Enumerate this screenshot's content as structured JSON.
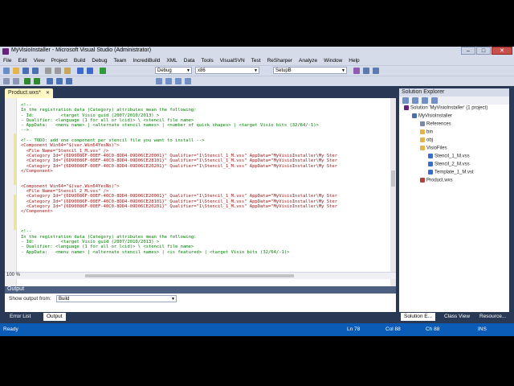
{
  "window": {
    "title": "MyVisioInstaller - Microsoft Visual Studio (Administrator)"
  },
  "menu": [
    "File",
    "Edit",
    "View",
    "Project",
    "Build",
    "Debug",
    "Team",
    "IncrediBuild",
    "XML",
    "Data",
    "Tools",
    "VisualSVN",
    "Test",
    "ReSharper",
    "Analyze",
    "Window",
    "Help"
  ],
  "toolbar": {
    "config": "Debug",
    "platform": "x86",
    "startup": "SetupB"
  },
  "editor": {
    "tab": "Product.wxs*",
    "zoom": "100 %",
    "lines": [
      {
        "c": "cm",
        "t": "<!--"
      },
      {
        "c": "cm",
        "t": "In the registration data (Category) attributes mean the following:"
      },
      {
        "c": "cm",
        "t": "- Id:          <target Visio guid (2007/2010/2013) >"
      },
      {
        "c": "cm",
        "t": "- Qualifier: <language (1 for all or lcid)> \\ <stencil file name>"
      },
      {
        "c": "cm",
        "t": "- AppData:   <menu name> | <alternate stencil names> | <number of quick shapes> | <target Visio bits (32/64/-1)>"
      },
      {
        "c": "cm",
        "t": "-->"
      },
      {
        "c": "",
        "t": ""
      },
      {
        "c": "cm",
        "t": "<!-- TODO: add one component per stencil file you want to install -->"
      },
      {
        "c": "tg",
        "t": "<Component Win64=\"$(var.Win64YesNo)\">"
      },
      {
        "c": "tg",
        "t": "  <File Name=\"Stencil_1_M.vss\" />"
      },
      {
        "c": "tg",
        "t": "  <Category Id=\"{6D90086F-00EF-40C0-8DD4-09D06CE20001}\" Qualifier=\"1\\Stencil_1_M.vss\" AppData=\"MyVisioInstaller\\My Ster"
      },
      {
        "c": "tg",
        "t": "  <Category Id=\"{6D90086F-00EF-40C0-8DD4-09D06CE28101}\" Qualifier=\"1\\Stencil_1_M.vss\" AppData=\"MyVisioInstaller\\My Ster"
      },
      {
        "c": "tg",
        "t": "  <Category Id=\"{6D90086F-00EF-40C0-8DD4-09D06CE20201}\" Qualifier=\"1\\Stencil_1_M.vss\" AppData=\"MyVisioInstaller\\My Ster"
      },
      {
        "c": "tg",
        "t": "</Component>"
      },
      {
        "c": "",
        "t": ""
      },
      {
        "c": "",
        "t": ""
      },
      {
        "c": "tg",
        "t": "<Component Win64=\"$(var.Win64YesNo)\">"
      },
      {
        "c": "tg",
        "t": "  <File Name=\"Stencil_2_M.vss\" />"
      },
      {
        "c": "tg",
        "t": "  <Category Id=\"{6D90086F-00EF-40C0-8DD4-09D06CE20001}\" Qualifier=\"1\\Stencil_1_M.vss\" AppData=\"MyVisioInstaller\\My Ster"
      },
      {
        "c": "tg",
        "t": "  <Category Id=\"{6D90086F-00EF-40C0-8DD4-09D06CE28101}\" Qualifier=\"1\\Stencil_1_M.vss\" AppData=\"MyVisioInstaller\\My Ster"
      },
      {
        "c": "tg",
        "t": "  <Category Id=\"{6D90086F-00EF-40C0-8DD4-09D06CE20201}\" Qualifier=\"1\\Stencil_1_M.vss\" AppData=\"MyVisioInstaller\\My Ster"
      },
      {
        "c": "tg",
        "t": "</Component>"
      },
      {
        "c": "",
        "t": ""
      },
      {
        "c": "",
        "t": ""
      },
      {
        "c": "",
        "t": ""
      },
      {
        "c": "cm",
        "t": "<!--"
      },
      {
        "c": "cm",
        "t": "In the registration data (Category) attributes mean the following:"
      },
      {
        "c": "cm",
        "t": "- Id:          <target Visio guid (2007/2010/2013) >"
      },
      {
        "c": "cm",
        "t": "- Qualifier: <language (1 for all or lcid)> \\ <stencil file name>"
      },
      {
        "c": "cm",
        "t": "- AppData:   <menu name> | <alternate stencil names> | <is featured> | <target Visio bits (32/64/-1)>"
      }
    ]
  },
  "output": {
    "title": "Output",
    "label": "Show output from:",
    "source": "Build"
  },
  "bottom_tabs": [
    "Error List",
    "Output"
  ],
  "status": {
    "ready": "Ready",
    "ln": "Ln 78",
    "col": "Col 88",
    "ch": "Ch 88",
    "ins": "INS"
  },
  "solution_explorer": {
    "title": "Solution Explorer",
    "nodes": [
      {
        "label": "Solution 'MyVisioInstaller' (1 project)",
        "icon": "solution-icon",
        "depth": 0
      },
      {
        "label": "MyVisioInstaller",
        "icon": "project-icon",
        "depth": 1
      },
      {
        "label": "References",
        "icon": "references-icon",
        "depth": 2
      },
      {
        "label": "bin",
        "icon": "folder-icon",
        "depth": 2
      },
      {
        "label": "obj",
        "icon": "folder-icon",
        "depth": 2
      },
      {
        "label": "VisioFiles",
        "icon": "folder-icon",
        "depth": 2
      },
      {
        "label": "Stencil_1_M.vss",
        "icon": "vss-file-icon",
        "depth": 3
      },
      {
        "label": "Stencil_2_M.vss",
        "icon": "vss-file-icon",
        "depth": 3
      },
      {
        "label": "Template_1_M.vst",
        "icon": "vst-file-icon",
        "depth": 3
      },
      {
        "label": "Product.wxs",
        "icon": "wxs-file-icon",
        "depth": 2
      }
    ],
    "tabs": [
      "Solution E...",
      "Class View",
      "Resource..."
    ]
  }
}
